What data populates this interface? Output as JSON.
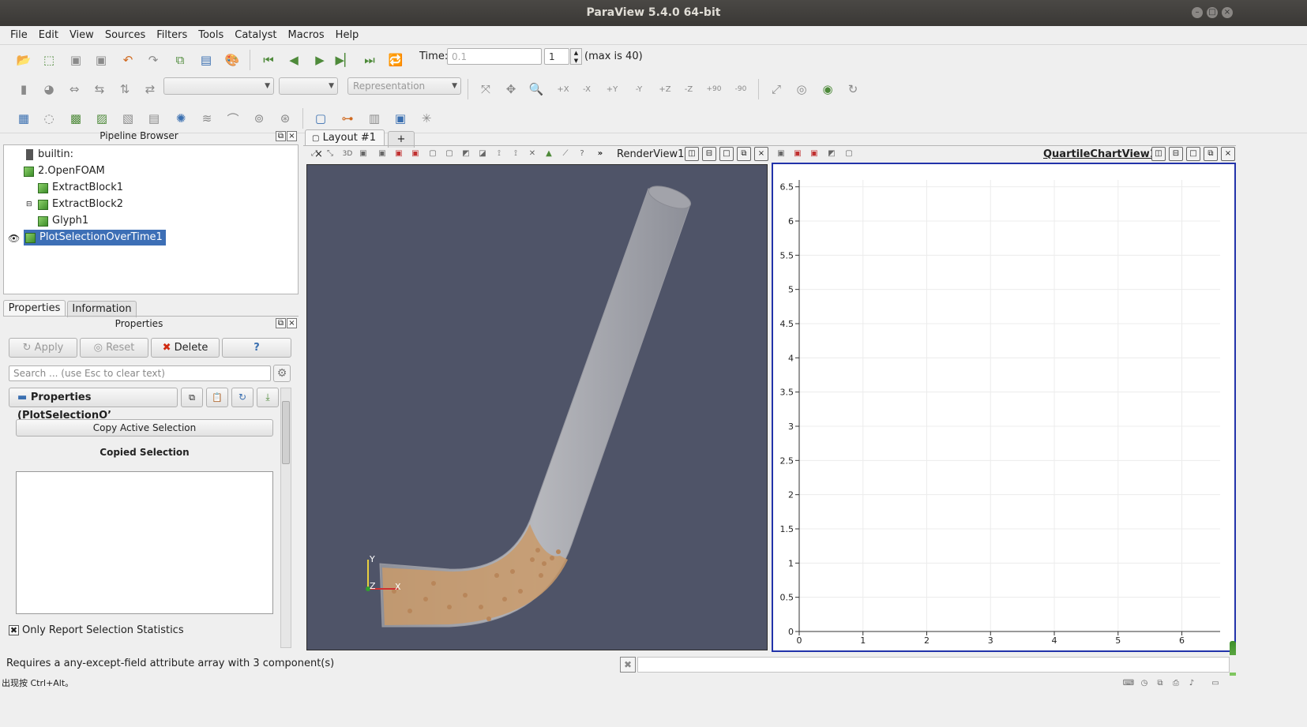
{
  "window": {
    "title": "ParaView 5.4.0 64-bit"
  },
  "menu": [
    "File",
    "Edit",
    "View",
    "Sources",
    "Filters",
    "Tools",
    "Catalyst",
    "Macros",
    "Help"
  ],
  "time_toolbar": {
    "time_label": "Time:",
    "time_value": "0.1",
    "step_value": "1",
    "max_label": "(max is 40)"
  },
  "representation_toolbar": {
    "representation_placeholder": "Representation"
  },
  "view_buttons": {
    "plus_x": "+X",
    "minus_x": "-X",
    "plus_y": "+Y",
    "minus_y": "-Y",
    "plus_z": "+Z",
    "minus_z": "-Z",
    "rot_plus": "+90",
    "rot_minus": "-90"
  },
  "pipeline_browser": {
    "title": "Pipeline Browser",
    "items": [
      {
        "label": "builtin:"
      },
      {
        "label": "2.OpenFOAM"
      },
      {
        "label": "ExtractBlock1"
      },
      {
        "label": "ExtractBlock2"
      },
      {
        "label": "Glyph1"
      },
      {
        "label": "PlotSelectionOverTime1",
        "selected": true
      }
    ]
  },
  "properties_panel": {
    "tabs": [
      "Properties",
      "Information"
    ],
    "title": "Properties",
    "apply_label": "Apply",
    "reset_label": "Reset",
    "delete_label": "Delete",
    "help_label": "?",
    "search_placeholder": "Search ... (use Esc to clear text)",
    "section_title": "Properties (PlotSelectionO’",
    "copy_selection_label": "Copy Active Selection",
    "copied_selection_label": "Copied Selection",
    "only_report_label": "Only Report Selection Statistics",
    "only_report_checked": true
  },
  "layout": {
    "tab_label": "Layout #1",
    "add_tab": "+",
    "render_view_label": "RenderView1",
    "render_3d_label": "3D",
    "chart_view_label": "QuartileChartView1",
    "axes": {
      "x": "X",
      "y": "Y",
      "z": "Z"
    }
  },
  "chart_data": {
    "type": "line",
    "series": [],
    "xlim": [
      0,
      6.6
    ],
    "ylim": [
      0,
      6.6
    ],
    "x_ticks": [
      "0",
      "1",
      "2",
      "3",
      "4",
      "5",
      "6"
    ],
    "y_ticks": [
      "0",
      "0.5",
      "1",
      "1.5",
      "2",
      "2.5",
      "3",
      "3.5",
      "4",
      "4.5",
      "5",
      "5.5",
      "6",
      "6.5"
    ],
    "grid": true
  },
  "status": {
    "message": "Requires a any-except-field attribute array with 3 component(s)",
    "ime_hint": "出现按 Ctrl+Alt。"
  },
  "colors": {
    "render_bg": "#4f5468",
    "selection": "#3d6fb6",
    "chart_border": "#2233aa"
  }
}
